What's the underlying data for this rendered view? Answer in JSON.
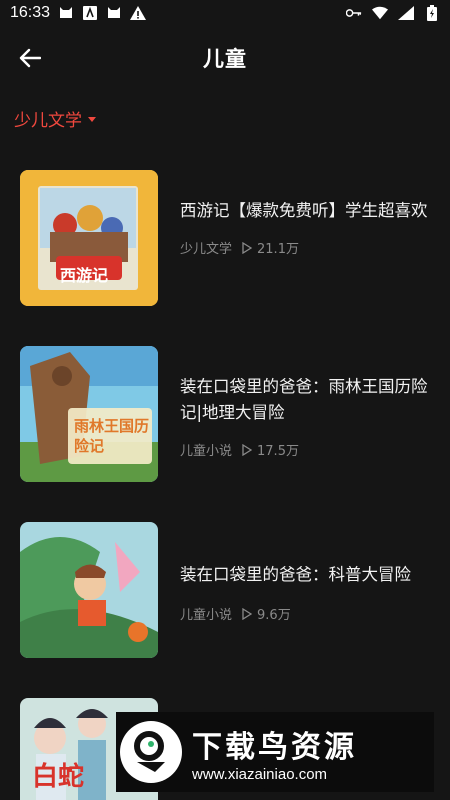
{
  "status_bar": {
    "time": "16:33"
  },
  "header": {
    "title": "儿童"
  },
  "filter": {
    "label": "少儿文学"
  },
  "items": [
    {
      "title": "西游记【爆款免费听】学生超喜欢",
      "category": "少儿文学",
      "plays": "21.1万",
      "cover_text": "西游记"
    },
    {
      "title": "装在口袋里的爸爸：雨林王国历险记|地理大冒险",
      "category": "儿童小说",
      "plays": "17.5万",
      "cover_text": "雨林王国历险记"
    },
    {
      "title": "装在口袋里的爸爸：科普大冒险",
      "category": "儿童小说",
      "plays": "9.6万",
      "cover_text": ""
    },
    {
      "title": "",
      "category": "",
      "plays": "",
      "cover_text": "白蛇"
    }
  ],
  "watermark": {
    "title": "下载鸟资源",
    "url": "www.xiazainiao.com"
  },
  "colors": {
    "accent": "#f0483e",
    "background": "#151515",
    "meta": "#8a8a8a"
  }
}
